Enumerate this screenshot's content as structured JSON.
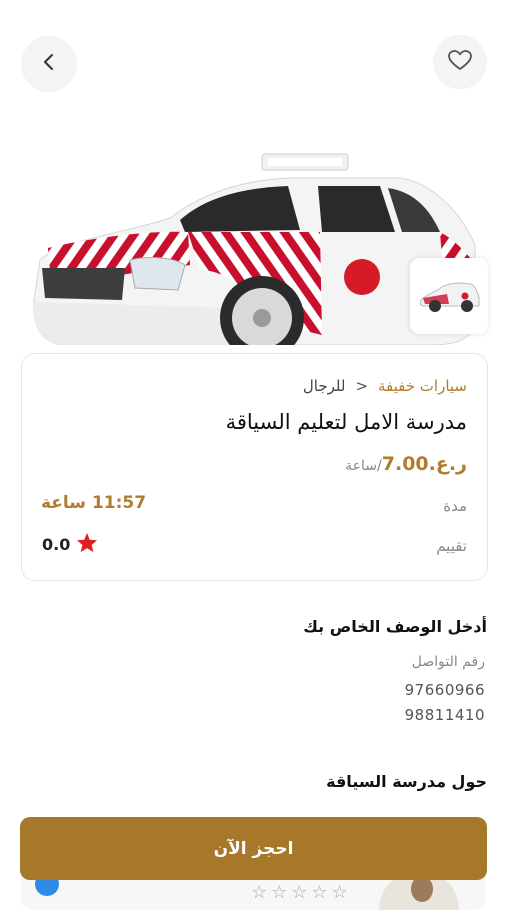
{
  "header": {
    "back_icon": "chevron-left-icon",
    "favorite_icon": "heart-outline-icon"
  },
  "listing": {
    "category": "سيارات خفيفة",
    "separator": "<",
    "subcategory": "للرجال",
    "title": "مدرسة الامل لتعليم السياقة",
    "price_amount": "ر.ع.7.00",
    "price_unit": "/ساعة",
    "duration_label": "مدة",
    "duration_value": "11:57 ساعة",
    "rating_label": "تقييم",
    "rating_value": "0.0",
    "rating_icon": "star-icon"
  },
  "description": {
    "title": "أدخل الوصف الخاص بك",
    "contact_label": "رقم التواصل",
    "phones": [
      "97660966",
      "98811410"
    ]
  },
  "about": {
    "title": "حول مدرسة السياقة"
  },
  "book_button": "احجز الآن",
  "colors": {
    "accent": "#b07d2d",
    "button": "#a8782a",
    "star": "#e02020"
  }
}
